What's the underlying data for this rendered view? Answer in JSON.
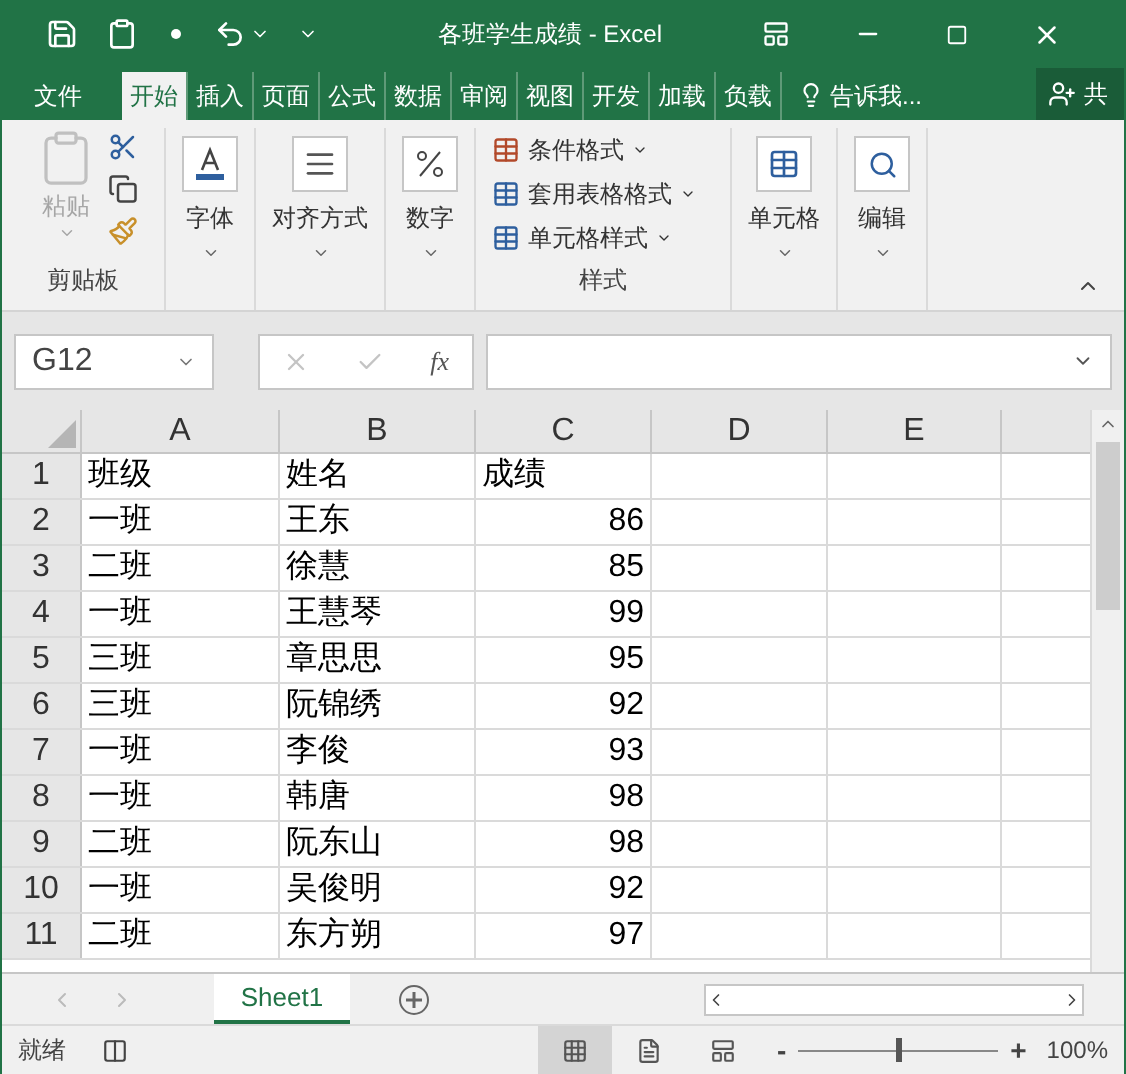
{
  "window": {
    "title": "各班学生成绩 - Excel"
  },
  "ribbon_tabs": [
    {
      "label": "文件",
      "selected": false
    },
    {
      "label": "开始",
      "selected": true
    },
    {
      "label": "插入",
      "selected": false
    },
    {
      "label": "页面",
      "selected": false
    },
    {
      "label": "公式",
      "selected": false
    },
    {
      "label": "数据",
      "selected": false
    },
    {
      "label": "审阅",
      "selected": false
    },
    {
      "label": "视图",
      "selected": false
    },
    {
      "label": "开发",
      "selected": false
    },
    {
      "label": "加载",
      "selected": false
    },
    {
      "label": "负载",
      "selected": false
    }
  ],
  "tell_me": "告诉我...",
  "share": "共",
  "clipboard": {
    "label": "剪贴板",
    "paste": {
      "label": "粘贴",
      "disabled": true
    }
  },
  "group_buttons": [
    {
      "kind": "font",
      "label": "字体"
    },
    {
      "kind": "align",
      "label": "对齐方式"
    },
    {
      "kind": "number",
      "label": "数字"
    }
  ],
  "styles": {
    "label": "样式",
    "items": [
      "条件格式",
      "套用表格格式",
      "单元格样式"
    ]
  },
  "group_buttons_2": [
    {
      "kind": "cells",
      "label": "单元格"
    },
    {
      "kind": "edit",
      "label": "编辑"
    }
  ],
  "formula_bar": {
    "name_box": "G12",
    "function_label": "fx"
  },
  "columns": [
    "A",
    "B",
    "C",
    "D",
    "E"
  ],
  "rows": [
    {
      "number": "1",
      "kind": "header",
      "cells": [
        "班级",
        "姓名",
        "成绩"
      ]
    },
    {
      "number": "2",
      "kind": "data",
      "cells": [
        "一班",
        "王东",
        "86"
      ]
    },
    {
      "number": "3",
      "kind": "data",
      "cells": [
        "二班",
        "徐慧",
        "85"
      ]
    },
    {
      "number": "4",
      "kind": "data",
      "cells": [
        "一班",
        "王慧琴",
        "99"
      ]
    },
    {
      "number": "5",
      "kind": "data",
      "cells": [
        "三班",
        "章思思",
        "95"
      ]
    },
    {
      "number": "6",
      "kind": "data",
      "cells": [
        "三班",
        "阮锦绣",
        "92"
      ]
    },
    {
      "number": "7",
      "kind": "data",
      "cells": [
        "一班",
        "李俊",
        "93"
      ]
    },
    {
      "number": "8",
      "kind": "data",
      "cells": [
        "一班",
        "韩唐",
        "98"
      ]
    },
    {
      "number": "9",
      "kind": "data",
      "cells": [
        "二班",
        "阮东山",
        "98"
      ]
    },
    {
      "number": "10",
      "kind": "data",
      "cells": [
        "一班",
        "吴俊明",
        "92"
      ]
    },
    {
      "number": "11",
      "kind": "data",
      "cells": [
        "二班",
        "东方朔",
        "97"
      ]
    }
  ],
  "sheets": [
    {
      "label": "Sheet1",
      "selected": true
    }
  ],
  "status_bar": {
    "text": "就绪",
    "views": [
      {
        "kind": "normal",
        "selected": true
      },
      {
        "kind": "page_layout",
        "selected": false
      },
      {
        "kind": "page_break",
        "selected": false
      }
    ],
    "zoom_out": "-",
    "zoom_in": "+",
    "zoom_slider": {
      "level": 0.5
    },
    "zoom": "100%"
  }
}
